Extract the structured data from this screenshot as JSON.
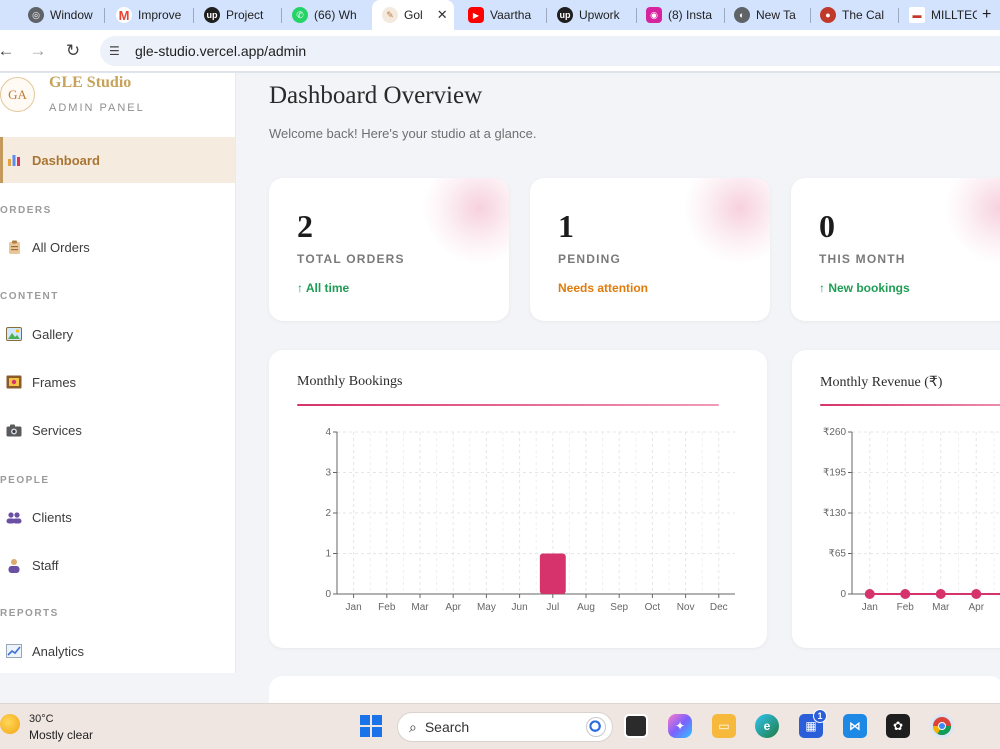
{
  "browser": {
    "tabs": [
      {
        "label": "Window",
        "icon": "globe-icon",
        "color": "#5f6368"
      },
      {
        "label": "Improve",
        "icon": "gmail-icon",
        "color": "#ea4335"
      },
      {
        "label": "Project",
        "icon": "upwork-icon",
        "color": "#1f1f1f"
      },
      {
        "label": "(66) Wh",
        "icon": "whatsapp-icon",
        "color": "#25d366"
      },
      {
        "label": "Gol",
        "icon": "gle-studio-icon",
        "color": "#c07a3a",
        "active": true
      },
      {
        "label": "Vaartha",
        "icon": "youtube-icon",
        "color": "#ff0000"
      },
      {
        "label": "Upwork",
        "icon": "upwork-icon",
        "color": "#1f1f1f"
      },
      {
        "label": "(8) Insta",
        "icon": "instagram-icon",
        "color": "#d6249f"
      },
      {
        "label": "New Ta",
        "icon": "chrome-icon",
        "color": "#5f6368"
      },
      {
        "label": "The Cal",
        "icon": "cake-icon",
        "color": "#c0392b"
      },
      {
        "label": "MILLTEC",
        "icon": "milltec-icon",
        "color": "#c0392b"
      }
    ],
    "tab_close": "✕",
    "new_tab": "+",
    "url": "gle-studio.vercel.app/admin"
  },
  "sidebar": {
    "avatar": "GA",
    "brand": "GLE Studio",
    "subtitle": "ADMIN PANEL",
    "dashboard": "Dashboard",
    "sections": {
      "orders": "ORDERS",
      "content": "CONTENT",
      "people": "PEOPLE",
      "reports": "REPORTS"
    },
    "items": {
      "all_orders": "All Orders",
      "gallery": "Gallery",
      "frames": "Frames",
      "services": "Services",
      "clients": "Clients",
      "staff": "Staff",
      "analytics": "Analytics"
    }
  },
  "main": {
    "title": "Dashboard Overview",
    "subtitle": "Welcome back! Here's your studio at a glance.",
    "stats": [
      {
        "value": "2",
        "label": "TOTAL ORDERS",
        "hint": "↑ All time",
        "hint_color": "#1f9d55"
      },
      {
        "value": "1",
        "label": "PENDING",
        "hint": "Needs attention",
        "hint_color": "#e07b0b"
      },
      {
        "value": "0",
        "label": "THIS MONTH",
        "hint": "↑ New bookings",
        "hint_color": "#1f9d55"
      }
    ]
  },
  "chart_data": [
    {
      "type": "bar",
      "title": "Monthly Bookings",
      "categories": [
        "Jan",
        "Feb",
        "Mar",
        "Apr",
        "May",
        "Jun",
        "Jul",
        "Aug",
        "Sep",
        "Oct",
        "Nov",
        "Dec"
      ],
      "values": [
        0,
        0,
        0,
        0,
        0,
        0,
        1,
        0,
        0,
        0,
        0,
        0
      ],
      "yticks": [
        "0",
        "1",
        "2",
        "3",
        "4"
      ],
      "ylim": [
        0,
        4
      ],
      "grid": true,
      "color": "#d6336c"
    },
    {
      "type": "line",
      "title": "Monthly Revenue (₹)",
      "categories": [
        "Jan",
        "Feb",
        "Mar",
        "Apr"
      ],
      "values": [
        0,
        0,
        0,
        0
      ],
      "yticks": [
        "0",
        "₹65",
        "₹130",
        "₹195",
        "₹260"
      ],
      "ylim": [
        0,
        260
      ],
      "grid": true,
      "color": "#d6336c"
    }
  ],
  "taskbar": {
    "temperature": "30°C",
    "weather": "Mostly clear",
    "search_label": "Search",
    "store_badge": "1"
  }
}
